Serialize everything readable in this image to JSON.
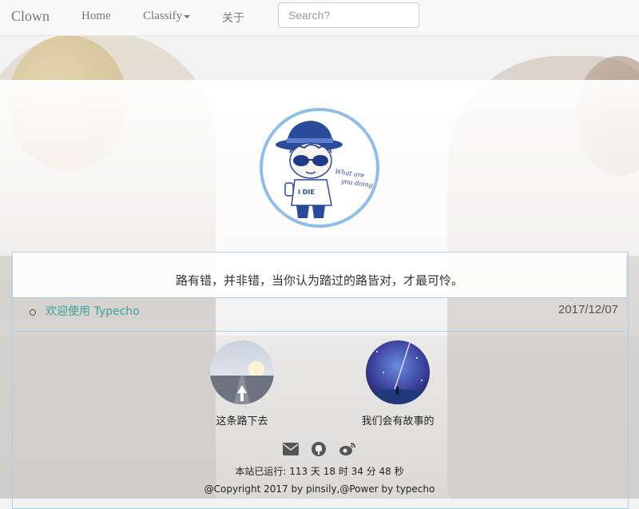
{
  "navbar": {
    "brand": "Clown",
    "home": "Home",
    "classify": "Classify",
    "about": "关于",
    "search_placeholder": "Search?"
  },
  "avatar": {
    "caption": "What are you doing",
    "shirt": "I DIE"
  },
  "quote": "路有错，并非错，当你认为踏过的路皆对，才最可怜。",
  "post": {
    "title": "欢迎使用 Typecho",
    "date": "2017/12/07"
  },
  "cards": [
    {
      "label": "这条路下去"
    },
    {
      "label": "我们会有故事的"
    }
  ],
  "social_icons": [
    "envelope-icon",
    "github-icon",
    "weibo-icon"
  ],
  "footer": {
    "runtime": "本站已运行: 113 天 18 时 34 分 48 秒",
    "copyright": "@Copyright 2017 by pinsily,@Power by typecho"
  },
  "colors": {
    "accent_link": "#3aa39a",
    "avatar_border": "#8fbde8",
    "panel_border": "#a9cfe6"
  }
}
